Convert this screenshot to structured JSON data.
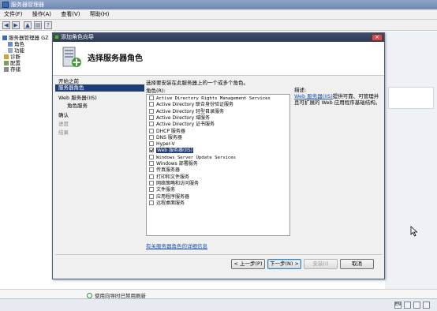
{
  "host": {
    "title": "服务器管理器",
    "menu": [
      "文件(F)",
      "操作(A)",
      "查看(V)",
      "帮助(H)"
    ],
    "tree": [
      {
        "label": "服务器管理器 GZ"
      },
      {
        "label": "角色"
      },
      {
        "label": "功能"
      },
      {
        "label": "诊断"
      },
      {
        "label": "配置"
      },
      {
        "label": "存储"
      }
    ],
    "status_text": "使用向导时已禁用刷新"
  },
  "wizard": {
    "title": "添加角色向导",
    "close_glyph": "×",
    "heading": "选择服务器角色",
    "steps": [
      {
        "label": "开始之前",
        "state": "normal"
      },
      {
        "label": "服务器角色",
        "state": "active"
      },
      {
        "label": "Web 服务器(IIS)",
        "state": "normal"
      },
      {
        "label": "角色服务",
        "state": "sub"
      },
      {
        "label": "确认",
        "state": "normal"
      },
      {
        "label": "进度",
        "state": "disabled"
      },
      {
        "label": "结果",
        "state": "disabled"
      }
    ],
    "instruction": "选择要安装在此服务器上的一个或多个角色。",
    "roles_label": "角色(R):",
    "roles": [
      {
        "label": "Active Directory Rights Management Services",
        "checked": false
      },
      {
        "label": "Active Directory 联合身份验证服务",
        "checked": false
      },
      {
        "label": "Active Directory 轻型目录服务",
        "checked": false
      },
      {
        "label": "Active Directory 域服务",
        "checked": false
      },
      {
        "label": "Active Directory 证书服务",
        "checked": false
      },
      {
        "label": "DHCP 服务器",
        "checked": false
      },
      {
        "label": "DNS 服务器",
        "checked": false
      },
      {
        "label": "Hyper-V",
        "checked": false
      },
      {
        "label": "Web 服务器(IIS)",
        "checked": true,
        "selected": true
      },
      {
        "label": "Windows Server Update Services",
        "checked": false
      },
      {
        "label": "Windows 部署服务",
        "checked": false
      },
      {
        "label": "传真服务器",
        "checked": false
      },
      {
        "label": "打印和文件服务",
        "checked": false
      },
      {
        "label": "网络策略和访问服务",
        "checked": false
      },
      {
        "label": "文件服务",
        "checked": false
      },
      {
        "label": "应用程序服务器",
        "checked": false
      },
      {
        "label": "远程桌面服务",
        "checked": false
      }
    ],
    "more_link": "有关服务器角色的详细信息",
    "description_title": "描述:",
    "description_link": "Web 服务器(IIS)",
    "description_rest": "提供可靠、可管理并且可扩展的 Web 应用程序基础结构。",
    "buttons": {
      "prev": "< 上一步(P)",
      "next": "下一步(N) >",
      "install": "安装(I)",
      "cancel": "取消"
    }
  },
  "taskbar": {
    "tray": [
      "EN",
      "",
      "",
      "",
      ""
    ]
  },
  "colors": {
    "selection": "#1e3c78",
    "link": "#1f4fb0",
    "wizard_title": "#2d3a54"
  }
}
